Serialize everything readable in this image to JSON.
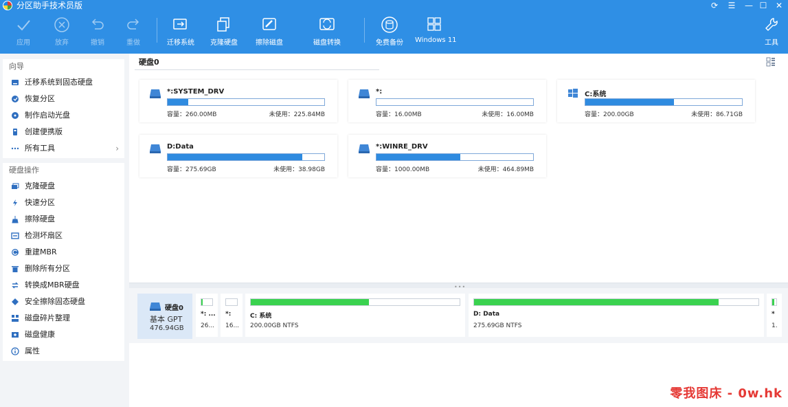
{
  "app": {
    "title": "分区助手技术员版"
  },
  "window_controls": [
    "refresh-icon",
    "menu-icon",
    "minimize-icon",
    "maximize-icon",
    "close-icon"
  ],
  "toolbar": {
    "apply": "应用",
    "discard": "放弃",
    "undo": "撤销",
    "redo": "重做",
    "migrate_os": "迁移系统",
    "clone_disk": "克隆硬盘",
    "wipe_disk": "擦除磁盘",
    "convert_disk": "磁盘转换",
    "free_backup": "免费备份",
    "windows11": "Windows 11",
    "tools": "工具"
  },
  "sidebar": {
    "wizard_header": "向导",
    "wizard_items": [
      {
        "label": "迁移系统到固态硬盘",
        "icon": "disk-migrate-icon"
      },
      {
        "label": "恢复分区",
        "icon": "recover-icon"
      },
      {
        "label": "制作启动光盘",
        "icon": "boot-disc-icon"
      },
      {
        "label": "创建便携版",
        "icon": "portable-icon"
      },
      {
        "label": "所有工具",
        "icon": "more-icon"
      }
    ],
    "ops_header": "硬盘操作",
    "ops_items": [
      {
        "label": "克隆硬盘",
        "icon": "clone-icon"
      },
      {
        "label": "快速分区",
        "icon": "lightning-icon"
      },
      {
        "label": "擦除硬盘",
        "icon": "broom-icon"
      },
      {
        "label": "检测坏扇区",
        "icon": "scan-icon"
      },
      {
        "label": "重建MBR",
        "icon": "rebuild-icon"
      },
      {
        "label": "删除所有分区",
        "icon": "trash-icon"
      },
      {
        "label": "转换成MBR硬盘",
        "icon": "convert-icon"
      },
      {
        "label": "安全擦除固态硬盘",
        "icon": "eraser-icon"
      },
      {
        "label": "磁盘碎片整理",
        "icon": "defrag-icon"
      },
      {
        "label": "磁盘健康",
        "icon": "health-icon"
      },
      {
        "label": "属性",
        "icon": "info-icon"
      }
    ]
  },
  "main": {
    "disk_tab": "硬盘0",
    "cards": [
      {
        "name": "*:SYSTEM_DRV",
        "capacity": "容量：260.00MB",
        "free": "未使用：225.84MB",
        "used_fraction": 0.13,
        "icon": "drive-icon"
      },
      {
        "name": "*:",
        "capacity": "容量：16.00MB",
        "free": "未使用：16.00MB",
        "used_fraction": 0.0,
        "icon": "drive-icon"
      },
      {
        "name": "C:系统",
        "capacity": "容量：200.00GB",
        "free": "未使用：86.71GB",
        "used_fraction": 0.566,
        "icon": "windows-icon"
      },
      {
        "name": "D:Data",
        "capacity": "容量：275.69GB",
        "free": "未使用：38.98GB",
        "used_fraction": 0.859,
        "icon": "drive-icon"
      },
      {
        "name": "*:WINRE_DRV",
        "capacity": "容量：1000.00MB",
        "free": "未使用：464.89MB",
        "used_fraction": 0.535,
        "icon": "drive-icon"
      }
    ]
  },
  "diskmap": {
    "disk_name": "硬盘0",
    "disk_type": "基本 GPT",
    "disk_size": "476.94GB",
    "partitions": [
      {
        "name": "*: ...",
        "desc": "26...",
        "used_fraction": 0.13
      },
      {
        "name": "*:",
        "desc": "16...",
        "used_fraction": 0.0
      },
      {
        "name": "C: 系统",
        "desc": "200.00GB NTFS",
        "used_fraction": 0.566
      },
      {
        "name": "D: Data",
        "desc": "275.69GB NTFS",
        "used_fraction": 0.859
      },
      {
        "name": "*",
        "desc": "1.",
        "used_fraction": 0.535
      }
    ]
  },
  "watermark": "零我图床 - 0w.hk",
  "colors": {
    "toolbar_bg": "#2f8fe5",
    "used_bar": "#2f8be0",
    "partition_bar": "#3ad24f"
  }
}
